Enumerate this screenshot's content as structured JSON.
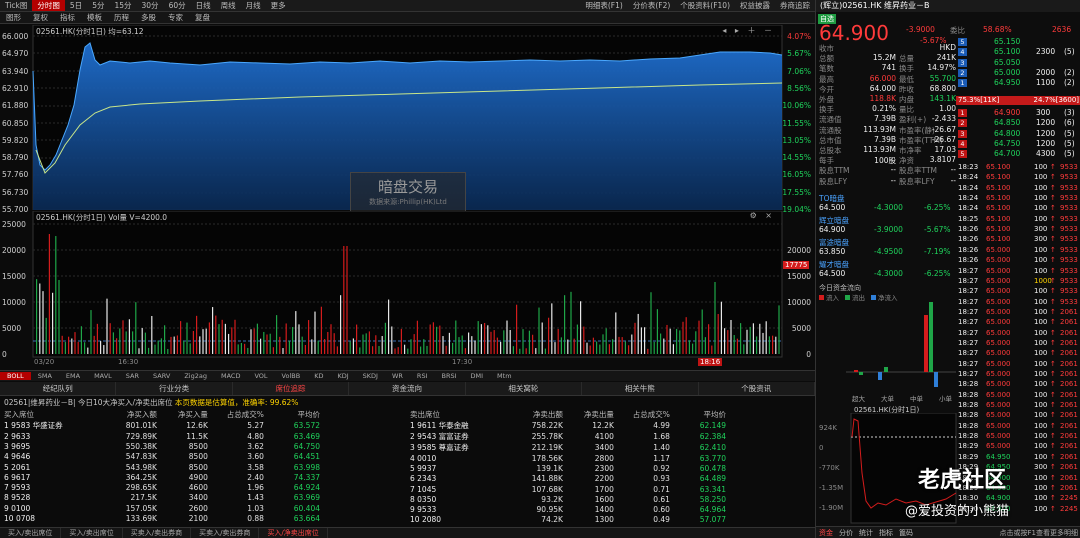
{
  "topbar": {
    "left": [
      "Tick图",
      "分时图",
      "5日",
      "5分",
      "15分",
      "30分",
      "60分",
      "日线",
      "周线",
      "月线",
      "更多"
    ],
    "active": 1,
    "right": [
      "明细表(F1)",
      "分价表(F2)",
      "个股资料(F10)",
      "权益披露",
      "券商追踪"
    ]
  },
  "toolbar2": [
    "图形",
    "复权",
    "指标",
    "模板",
    "历程",
    "多股",
    "专家",
    "复盘"
  ],
  "price_chart": {
    "title": "02561.HK(分时1日) 均=63.12",
    "y_left": [
      "66.000",
      "64.970",
      "63.940",
      "62.910",
      "61.880",
      "60.850",
      "59.820",
      "58.790",
      "57.760",
      "56.730",
      "55.700"
    ],
    "y_right": [
      "4.07%",
      "5.67%",
      "7.06%",
      "8.56%",
      "10.06%",
      "11.55%",
      "13.05%",
      "14.55%",
      "16.05%",
      "17.55%",
      "19.04%"
    ],
    "colors": {
      "fill": "#1b63b8",
      "line": "#3fa0ff",
      "avg": "#c8e68a"
    }
  },
  "watermark": {
    "title": "暗盘交易",
    "source": "数据来源:Phillip(HK)Ltd"
  },
  "vol_chart": {
    "title": "02561.HK(分时1日) Vol量 V=4200.0",
    "y_left": [
      "25000",
      "20000",
      "15000",
      "10000",
      "5000",
      "0"
    ],
    "y_right": [
      "20000",
      "15000",
      "10000",
      "5000",
      "0"
    ],
    "marker": "17775",
    "x_labels": [
      "03/20",
      "16:30",
      "17:30",
      "18:16"
    ]
  },
  "indicators": [
    "BOLL",
    "SMA",
    "EMA",
    "MAVL",
    "SAR",
    "SARV",
    "Zig2ag",
    "MACD",
    "VOL",
    "VolBB",
    "KD",
    "KDJ",
    "SKDJ",
    "WR",
    "RSI",
    "BRSI",
    "DMI",
    "Mtm"
  ],
  "tabs": [
    "经纪队列",
    "行业分类",
    "席位追踪",
    "资金流向",
    "相关窝轮",
    "相关牛熊",
    "个股资讯"
  ],
  "active_tab": 2,
  "info_line": {
    "prefix": "02561|维昇药业－B| 今日10大净买入/净卖出席位",
    "highlight": "本页数据是估算值，准确率: 99.62%"
  },
  "buy_table": {
    "headers": [
      "买入席位",
      "净买入额",
      "净买入量",
      "占总成交%",
      "平均价"
    ],
    "rows": [
      [
        "1",
        "9583",
        "华盛证券",
        "801.01K",
        "12.6K",
        "5.27",
        "63.572"
      ],
      [
        "2",
        "9633",
        "",
        "729.89K",
        "11.5K",
        "4.80",
        "63.469"
      ],
      [
        "3",
        "9695",
        "",
        "550.38K",
        "8500",
        "3.62",
        "64.750"
      ],
      [
        "4",
        "9646",
        "",
        "547.83K",
        "8500",
        "3.60",
        "64.451"
      ],
      [
        "5",
        "2061",
        "",
        "543.98K",
        "8500",
        "3.58",
        "63.998"
      ],
      [
        "6",
        "9617",
        "",
        "364.25K",
        "4900",
        "2.40",
        "74.337"
      ],
      [
        "7",
        "9593",
        "",
        "298.65K",
        "4600",
        "1.96",
        "64.924"
      ],
      [
        "8",
        "9528",
        "",
        "217.5K",
        "3400",
        "1.43",
        "63.969"
      ],
      [
        "9",
        "0100",
        "",
        "157.05K",
        "2600",
        "1.03",
        "60.404"
      ],
      [
        "10",
        "0708",
        "",
        "133.69K",
        "2100",
        "0.88",
        "63.664"
      ]
    ]
  },
  "sell_table": {
    "headers": [
      "卖出席位",
      "净卖出额",
      "净卖出量",
      "占总成交%",
      "平均价"
    ],
    "rows": [
      [
        "1",
        "9611",
        "华泰金融",
        "758.22K",
        "12.2K",
        "4.99",
        "62.149"
      ],
      [
        "2",
        "9543",
        "富富证券",
        "255.78K",
        "4100",
        "1.68",
        "62.384"
      ],
      [
        "3",
        "9585",
        "尊嘉证券",
        "212.19K",
        "3400",
        "1.40",
        "62.410"
      ],
      [
        "4",
        "0010",
        "",
        "178.56K",
        "2800",
        "1.17",
        "63.770"
      ],
      [
        "5",
        "9937",
        "",
        "139.1K",
        "2300",
        "0.92",
        "60.478"
      ],
      [
        "6",
        "2343",
        "",
        "141.88K",
        "2200",
        "0.93",
        "64.489"
      ],
      [
        "7",
        "1045",
        "",
        "107.68K",
        "1700",
        "0.71",
        "63.341"
      ],
      [
        "8",
        "0350",
        "",
        "93.2K",
        "1600",
        "0.61",
        "58.250"
      ],
      [
        "9",
        "9533",
        "",
        "90.95K",
        "1400",
        "0.60",
        "64.964"
      ],
      [
        "10",
        "2080",
        "",
        "74.2K",
        "1300",
        "0.49",
        "57.077"
      ]
    ]
  },
  "bottom_tabs": [
    "买入/卖出席位",
    "买入/卖出席位",
    "买卖入/卖出券商",
    "买卖入/卖出券商",
    "买入/净卖出席位"
  ],
  "bottom_active": 4,
  "right": {
    "title": "(辉立)02561.HK  维昇药业－B",
    "self_select": "自选",
    "price": "64.900",
    "change": "-3.9000",
    "change_pct": "-5.67%",
    "ratio_label": "委比",
    "ratio": "58.68%",
    "ratio_num": "2636",
    "stats": [
      [
        "收市",
        "",
        "",
        "HKD"
      ],
      [
        "总额",
        "15.2M",
        "总量",
        "241K"
      ],
      [
        "笔数",
        "741",
        "换手",
        "14.97%"
      ],
      [
        "最高",
        "66.000",
        "最低",
        "55.700"
      ],
      [
        "今开",
        "64.000",
        "昨收",
        "68.800"
      ],
      [
        "外盘",
        "118.8K",
        "内盘",
        "143.1K"
      ],
      [
        "换手",
        "0.21%",
        "量比",
        "1.00"
      ],
      [
        "流通值",
        "7.39B",
        "盈利(+)",
        "-2.433"
      ],
      [
        "流通股",
        "113.93M",
        "市盈率(静)",
        "-26.67"
      ],
      [
        "总市值",
        "7.39B",
        "市盈率(TTM)",
        "-26.67"
      ],
      [
        "总股本",
        "113.93M",
        "市净率",
        "17.03"
      ],
      [
        "每手",
        "100股",
        "净资",
        "3.8107"
      ],
      [
        "股息TTM",
        "--",
        "股息率TTM",
        "--"
      ],
      [
        "股息LFY",
        "--",
        "股息率LFY",
        "--"
      ]
    ],
    "asks": [
      [
        "5",
        "65.150",
        "",
        ""
      ],
      [
        "4",
        "65.100",
        "2300",
        "5"
      ],
      [
        "3",
        "65.050",
        "",
        ""
      ],
      [
        "2",
        "65.000",
        "2000",
        "2"
      ],
      [
        "1",
        "64.950",
        "1100",
        "2"
      ]
    ],
    "bid_ratio": {
      "left": "75.3%[11K]",
      "right": "24.7%[3600]"
    },
    "bids": [
      [
        "1",
        "64.900",
        "300",
        "3"
      ],
      [
        "2",
        "64.850",
        "1200",
        "6"
      ],
      [
        "3",
        "64.800",
        "1200",
        "5"
      ],
      [
        "4",
        "64.750",
        "1200",
        "5"
      ],
      [
        "5",
        "64.700",
        "4300",
        "5"
      ]
    ],
    "dark_markets": [
      {
        "name": "TO暗盘",
        "price": "64.500",
        "change": "-4.3000",
        "pct": "-6.25%"
      },
      {
        "name": "辉立暗盘",
        "price": "64.900",
        "change": "-3.9000",
        "pct": "-5.67%"
      },
      {
        "name": "富途暗盘",
        "price": "63.850",
        "change": "-4.9500",
        "pct": "-7.19%"
      },
      {
        "name": "耀才暗盘",
        "price": "64.500",
        "change": "-4.3000",
        "pct": "-6.25%"
      }
    ],
    "cashflow_title": "今日资金流向",
    "cashflow_legend": [
      "流入",
      "流出",
      "净流入"
    ],
    "cashflow_cats": [
      "超大",
      "大单",
      "中单",
      "小单"
    ],
    "mini_chart": {
      "title": "02561.HK(分时1日)",
      "y": [
        "924K",
        "0",
        "-770K",
        "-1.35M",
        "-1.90M"
      ]
    },
    "trades": [
      [
        "18:23",
        "65.100",
        "100",
        "9533"
      ],
      [
        "18:24",
        "65.100",
        "100",
        "9533"
      ],
      [
        "18:24",
        "65.100",
        "100",
        "9533"
      ],
      [
        "18:24",
        "65.100",
        "100",
        "9533"
      ],
      [
        "18:24",
        "65.100",
        "100",
        "9533"
      ],
      [
        "18:25",
        "65.100",
        "100",
        "9533"
      ],
      [
        "18:26",
        "65.100",
        "300",
        "9533"
      ],
      [
        "18:26",
        "65.100",
        "300",
        "9533"
      ],
      [
        "18:26",
        "65.000",
        "100",
        "9533"
      ],
      [
        "18:26",
        "65.000",
        "100",
        "9533"
      ],
      [
        "18:27",
        "65.000",
        "100",
        "9533"
      ],
      [
        "18:27",
        "65.000",
        "1000",
        "9533"
      ],
      [
        "18:27",
        "65.000",
        "100",
        "9533"
      ],
      [
        "18:27",
        "65.000",
        "100",
        "9533"
      ],
      [
        "18:27",
        "65.000",
        "100",
        "2061"
      ],
      [
        "18:27",
        "65.000",
        "100",
        "2061"
      ],
      [
        "18:27",
        "65.000",
        "100",
        "2061"
      ],
      [
        "18:27",
        "65.000",
        "100",
        "2061"
      ],
      [
        "18:27",
        "65.000",
        "100",
        "2061"
      ],
      [
        "18:27",
        "65.000",
        "100",
        "2061"
      ],
      [
        "18:27",
        "65.000",
        "100",
        "2061"
      ],
      [
        "18:28",
        "65.000",
        "100",
        "2061"
      ],
      [
        "18:28",
        "65.000",
        "100",
        "2061"
      ],
      [
        "18:28",
        "65.000",
        "100",
        "2061"
      ],
      [
        "18:28",
        "65.000",
        "100",
        "2061"
      ],
      [
        "18:28",
        "65.000",
        "100",
        "2061"
      ],
      [
        "18:28",
        "65.000",
        "100",
        "2061"
      ],
      [
        "18:29",
        "65.000",
        "100",
        "2061"
      ],
      [
        "18:29",
        "64.950",
        "100",
        "2061"
      ],
      [
        "18:29",
        "64.950",
        "300",
        "2061"
      ],
      [
        "18:29",
        "64.900",
        "100",
        "2061"
      ],
      [
        "18:29",
        "64.900",
        "100",
        "2061"
      ],
      [
        "18:30",
        "64.900",
        "100",
        "2245"
      ],
      [
        "18:30",
        "64.900",
        "100",
        "2245"
      ]
    ],
    "bottom": [
      "资金",
      "分价",
      "统计",
      "指标",
      "篦码"
    ],
    "bottom_note": "点击或按F1查看更多明细"
  },
  "watermarks": {
    "logo": "老虎社区",
    "author": "@爱投资的小熊猫"
  }
}
